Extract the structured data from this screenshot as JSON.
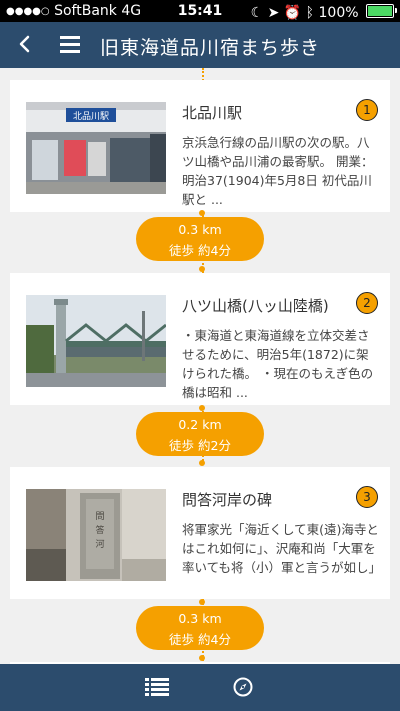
{
  "status": {
    "carrier": "SoftBank",
    "network": "4G",
    "time": "15:41",
    "battery": "100%"
  },
  "nav": {
    "title": "旧東海道品川宿まち歩き"
  },
  "colors": {
    "nav": "#2c4c6d",
    "accent": "#f5a000"
  },
  "spots": [
    {
      "number": "1",
      "name": "北品川駅",
      "description": "京浜急行線の品川駅の次の駅。八ツ山橋や品川浦の最寄駅。 開業：明治37(1904)年5月8日 初代品川駅と ..."
    },
    {
      "number": "2",
      "name": "八ツ山橋(八ッ山陸橋)",
      "description": "・東海道と東海道線を立体交差させるために、明治5年(1872)に架けられた橋。 ・現在のもえぎ色の橋は昭和 ..."
    },
    {
      "number": "3",
      "name": "問答河岸の碑",
      "description": "将軍家光「海近くして東(遠)海寺とはこれ如何に」、沢庵和尚「大軍を率いても将（小）軍と言うが如し」"
    }
  ],
  "legs": [
    {
      "distance": "0.3 km",
      "walk": "徒歩 約4分"
    },
    {
      "distance": "0.2 km",
      "walk": "徒歩 約2分"
    },
    {
      "distance": "0.3 km",
      "walk": "徒歩 約4分"
    }
  ],
  "tabbar": {
    "icons": [
      "list-icon",
      "compass-icon"
    ]
  }
}
